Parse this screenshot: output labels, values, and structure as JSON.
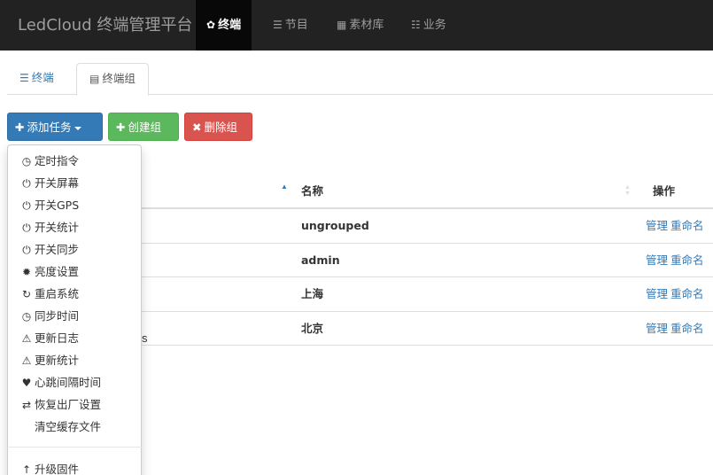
{
  "navbar": {
    "brand": "LedCloud 终端管理平台",
    "items": [
      {
        "label": "终端",
        "icon": "gear-icon",
        "glyph": "✿"
      },
      {
        "label": "节目",
        "icon": "list-icon",
        "glyph": "☰"
      },
      {
        "label": "素材库",
        "icon": "grid-icon",
        "glyph": "▦"
      },
      {
        "label": "业务",
        "icon": "tasks-icon",
        "glyph": "☷"
      }
    ]
  },
  "tabs": [
    {
      "label": "终端",
      "icon": "list-icon",
      "glyph": "☰"
    },
    {
      "label": "终端组",
      "icon": "table-icon",
      "glyph": "▤"
    }
  ],
  "toolbar": {
    "add_task": "添加任务",
    "create_group": "创建组",
    "delete_group": "删除组",
    "plus_glyph": "✚",
    "remove_glyph": "✖"
  },
  "table": {
    "columns": [
      "名称",
      "操作"
    ],
    "rows": [
      {
        "name": "ungrouped",
        "manage": "管理",
        "rename": "重命名"
      },
      {
        "name": "admin",
        "manage": "管理",
        "rename": "重命名"
      },
      {
        "name": "上海",
        "manage": "管理",
        "rename": "重命名"
      },
      {
        "name": "北京",
        "manage": "管理",
        "rename": "重命名"
      }
    ],
    "info_suffix": "s"
  },
  "dropdown": {
    "items": [
      {
        "label": "定时指令",
        "icon": "clock-icon",
        "glyph": "◷"
      },
      {
        "label": "开关屏幕",
        "icon": "power-icon",
        "glyph": "⏻"
      },
      {
        "label": "开关GPS",
        "icon": "power-icon",
        "glyph": "⏻"
      },
      {
        "label": "开关统计",
        "icon": "power-icon",
        "glyph": "⏻"
      },
      {
        "label": "开关同步",
        "icon": "power-icon",
        "glyph": "⏻"
      },
      {
        "label": "亮度设置",
        "icon": "brightness-icon",
        "glyph": "✹"
      },
      {
        "label": "重启系统",
        "icon": "refresh-icon",
        "glyph": "↻"
      },
      {
        "label": "同步时间",
        "icon": "clock-icon",
        "glyph": "◷"
      },
      {
        "label": "更新日志",
        "icon": "warning-icon",
        "glyph": "⚠"
      },
      {
        "label": "更新统计",
        "icon": "warning-icon",
        "glyph": "⚠"
      },
      {
        "label": "心跳间隔时间",
        "icon": "heart-icon",
        "glyph": "♥"
      },
      {
        "label": "恢复出厂设置",
        "icon": "retweet-icon",
        "glyph": "⇄"
      },
      {
        "label": "清空缓存文件",
        "icon": "",
        "glyph": ""
      },
      {
        "label": "升级固件",
        "icon": "arrow-up-icon",
        "glyph": "↑"
      }
    ]
  }
}
